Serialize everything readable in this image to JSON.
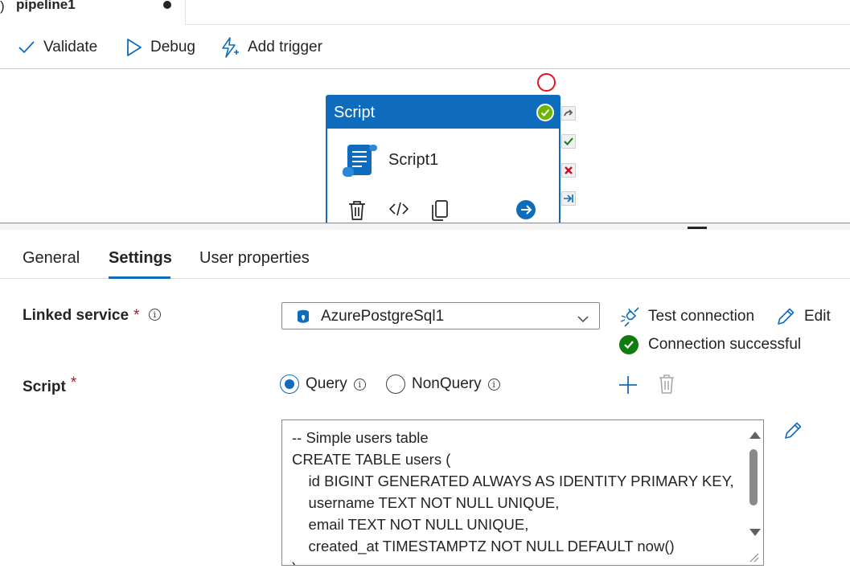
{
  "tab": {
    "title": "pipeline1",
    "prev_edge": ")"
  },
  "toolbar": {
    "validate_label": "Validate",
    "debug_label": "Debug",
    "add_trigger_label": "Add trigger"
  },
  "activity": {
    "type_label": "Script",
    "name": "Script1",
    "status": "succeeded"
  },
  "tabs": [
    {
      "label": "General",
      "active": false
    },
    {
      "label": "Settings",
      "active": true
    },
    {
      "label": "User properties",
      "active": false
    }
  ],
  "settings": {
    "linked_service": {
      "label": "Linked service",
      "required_mark": "*",
      "info_glyph": "i",
      "value": "AzurePostgreSql1",
      "test_connection_label": "Test connection",
      "edit_label": "Edit",
      "connection_status": "Connection successful"
    },
    "script": {
      "label": "Script",
      "required_mark": "*",
      "query_label": "Query",
      "nonquery_label": "NonQuery",
      "info_glyph": "i",
      "selected": "Query",
      "text": "-- Simple users table\nCREATE TABLE users (\n    id BIGINT GENERATED ALWAYS AS IDENTITY PRIMARY KEY,\n    username TEXT NOT NULL UNIQUE,\n    email TEXT NOT NULL UNIQUE,\n    created_at TIMESTAMPTZ NOT NULL DEFAULT now()\n);"
    }
  },
  "colors": {
    "accent": "#0f6cbd",
    "success": "#107c10",
    "activity_ok": "#6bb700",
    "error": "#c50f1f"
  },
  "icons": {
    "validate": "checkmark-icon",
    "debug": "play-outline-icon",
    "trigger": "flash-add-icon",
    "test_connection": "plug-disconnected-icon",
    "edit": "pencil-icon",
    "add": "plus-icon",
    "delete": "trash-icon"
  }
}
